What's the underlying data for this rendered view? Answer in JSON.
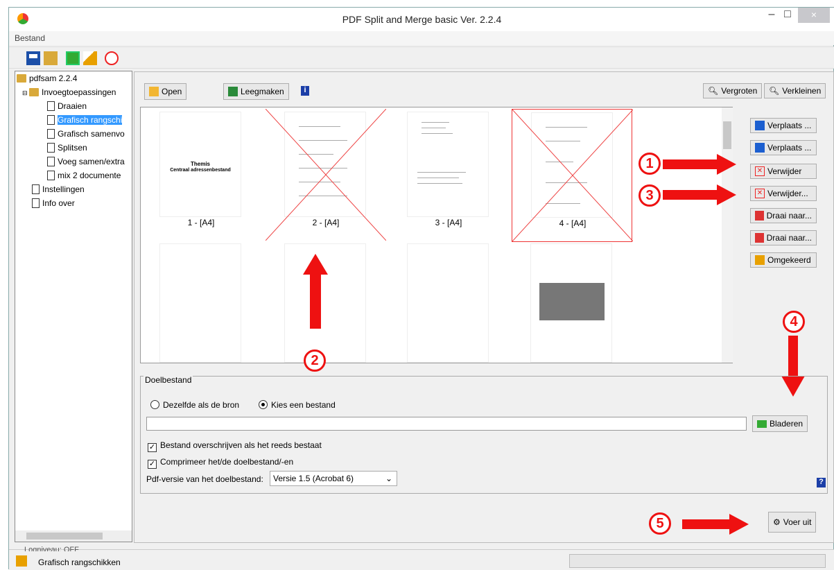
{
  "window": {
    "title": "PDF Split and Merge basic Ver. 2.2.4",
    "minimize": "‒",
    "maximize": "□",
    "close": "×"
  },
  "menu": {
    "file": "Bestand"
  },
  "tree": {
    "root": "pdfsam 2.2.4",
    "group": "Invoegtoepassingen",
    "items": [
      "Draaien",
      "Grafisch rangschi",
      "Grafisch samenvo",
      "Splitsen",
      "Voeg samen/extra",
      "mix 2 documente"
    ],
    "settings": "Instellingen",
    "about": "Info over"
  },
  "top": {
    "open": "Open",
    "clear": "Leegmaken",
    "zoom_in": "Vergroten",
    "zoom_out": "Verkleinen"
  },
  "pages": [
    {
      "label": "1 - [A4]",
      "title1": "Themis",
      "title2": "Centraal adressenbestand",
      "removed": false
    },
    {
      "label": "2 - [A4]",
      "removed": true
    },
    {
      "label": "3 - [A4]",
      "removed": false
    },
    {
      "label": "4 - [A4]",
      "removed": true
    }
  ],
  "side_buttons": [
    "Verplaats ...",
    "Verplaats ...",
    "Verwijder",
    "Verwijder...",
    "Draai naar...",
    "Draai naar...",
    "Omgekeerd"
  ],
  "annotations": [
    "1",
    "2",
    "3",
    "4",
    "5"
  ],
  "target": {
    "legend": "Doelbestand",
    "same_as_source": "Dezelfde als de bron",
    "choose_file": "Kies een bestand",
    "path": "",
    "browse": "Bladeren",
    "overwrite": "Bestand overschrijven als het reeds bestaat",
    "compress": "Comprimeer het/de doelbestand/-en",
    "version_label": "Pdf-versie van het doelbestand:",
    "version_value": "Versie 1.5 (Acrobat 6)",
    "help": "?"
  },
  "run": "Voer uit",
  "status": {
    "log": "Logniveau: OFF",
    "plugin": "Grafisch rangschikken"
  }
}
